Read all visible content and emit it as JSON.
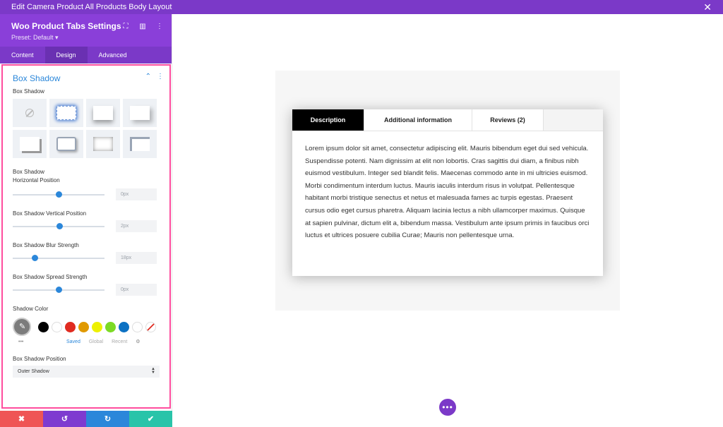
{
  "topbar": {
    "title": "Edit Camera Product All Products Body Layout",
    "close": "✕"
  },
  "panel": {
    "title": "Woo Product Tabs Settings",
    "preset": "Preset: Default ▾",
    "icons": [
      "fullscreen-icon",
      "sidebar-icon",
      "more-icon"
    ],
    "tabs": [
      {
        "label": "Content"
      },
      {
        "label": "Design"
      },
      {
        "label": "Advanced"
      }
    ],
    "active_tab": "Design"
  },
  "box_shadow": {
    "section_title": "Box Shadow",
    "preset_label": "Box Shadow",
    "horizontal": {
      "label": "Box Shadow Horizontal Position",
      "value": "0px",
      "slider": 0.5
    },
    "vertical": {
      "label": "Box Shadow Vertical Position",
      "value": "2px",
      "slider": 0.51
    },
    "blur": {
      "label": "Box Shadow Blur Strength",
      "value": "18px",
      "slider": 0.24
    },
    "spread": {
      "label": "Box Shadow Spread Strength",
      "value": "0px",
      "slider": 0.5
    },
    "color": {
      "label": "Shadow Color",
      "swatches": [
        "#000000",
        "#ffffff",
        "#e02b20",
        "#e09900",
        "#edf000",
        "#7cda24",
        "#0c71c3",
        "#ffffff",
        "none"
      ],
      "tabs": [
        "Saved",
        "Global",
        "Recent"
      ],
      "active": "Saved",
      "more": "•••"
    },
    "position": {
      "label": "Box Shadow Position",
      "value": "Outer Shadow"
    }
  },
  "bottom_bar": [
    {
      "icon": "✖",
      "color": "#ef5555"
    },
    {
      "icon": "↺",
      "color": "#7e3bd0"
    },
    {
      "icon": "↻",
      "color": "#2b87da"
    },
    {
      "icon": "✔",
      "color": "#29c4a9"
    }
  ],
  "preview": {
    "tabs": [
      "Description",
      "Additional information",
      "Reviews (2)"
    ],
    "active_tab": "Description",
    "body": "Lorem ipsum dolor sit amet, consectetur adipiscing elit. Mauris bibendum eget dui sed vehicula. Suspendisse potenti. Nam dignissim at elit non lobortis. Cras sagittis dui diam, a finibus nibh euismod vestibulum. Integer sed blandit felis. Maecenas commodo ante in mi ultricies euismod. Morbi condimentum interdum luctus. Mauris iaculis interdum risus in volutpat. Pellentesque habitant morbi tristique senectus et netus et malesuada fames ac turpis egestas. Praesent cursus odio eget cursus pharetra. Aliquam lacinia lectus a nibh ullamcorper maximus. Quisque at sapien pulvinar, dictum elit a, bibendum massa. Vestibulum ante ipsum primis in faucibus orci luctus et ultrices posuere cubilia Curae; Mauris non pellentesque urna."
  },
  "fab": "•••"
}
